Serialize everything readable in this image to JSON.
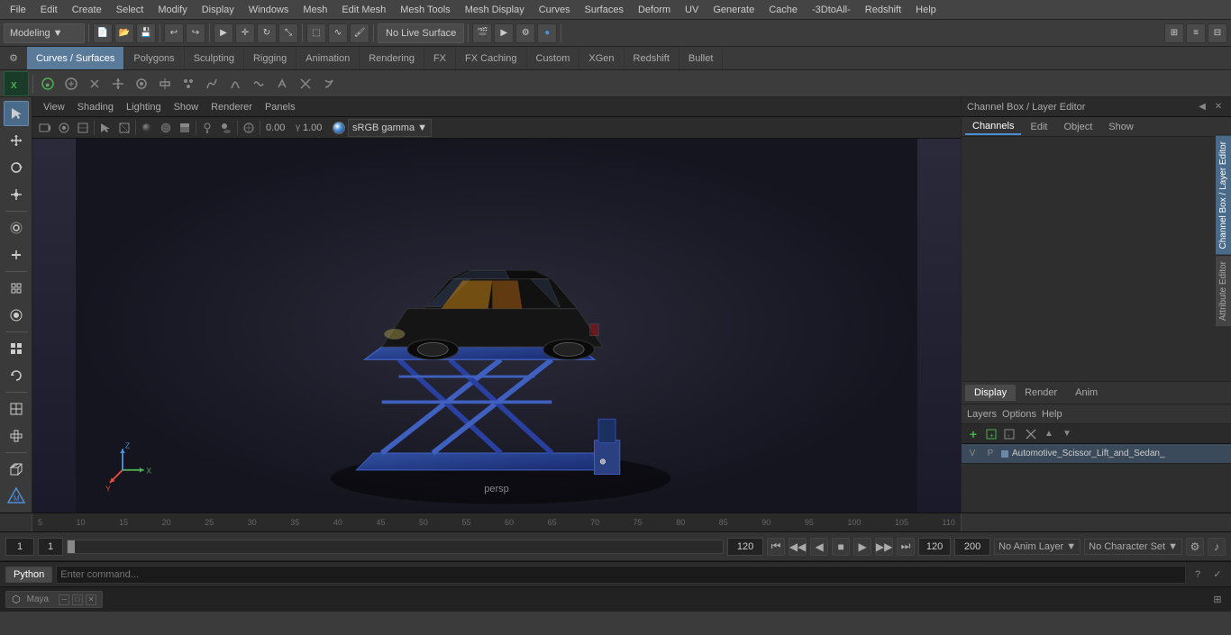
{
  "app": {
    "title": "Autodesk Maya"
  },
  "menu": {
    "items": [
      "File",
      "Edit",
      "Create",
      "Select",
      "Modify",
      "Display",
      "Windows",
      "Mesh",
      "Edit Mesh",
      "Mesh Tools",
      "Mesh Display",
      "Curves",
      "Surfaces",
      "Deform",
      "UV",
      "Generate",
      "Cache",
      "-3DtoAll-",
      "Redshift",
      "Help"
    ]
  },
  "toolbar": {
    "modeling_label": "Modeling",
    "live_surface": "No Live Surface"
  },
  "mode_tabs": {
    "tabs": [
      "Curves / Surfaces",
      "Polygons",
      "Sculpting",
      "Rigging",
      "Animation",
      "Rendering",
      "FX",
      "FX Caching",
      "Custom",
      "XGen",
      "Redshift",
      "Bullet"
    ]
  },
  "viewport": {
    "menus": [
      "View",
      "Shading",
      "Lighting",
      "Show",
      "Renderer",
      "Panels"
    ],
    "label": "persp",
    "gamma_value": "0.00",
    "gamma_mult": "1.00",
    "color_space": "sRGB gamma",
    "camera_name": "persp"
  },
  "channel_box": {
    "title": "Channel Box / Layer Editor",
    "tabs": [
      "Channels",
      "Edit",
      "Object",
      "Show"
    ]
  },
  "display_tabs": [
    "Display",
    "Render",
    "Anim"
  ],
  "layers": {
    "header_tabs": [
      "Layers",
      "Options",
      "Help"
    ],
    "layer_name": "Automotive_Scissor_Lift_and_Sedan_"
  },
  "timeline": {
    "ruler_marks": [
      "5",
      "10",
      "15",
      "20",
      "25",
      "30",
      "35",
      "40",
      "45",
      "50",
      "55",
      "60",
      "65",
      "70",
      "75",
      "80",
      "85",
      "90",
      "95",
      "100",
      "105",
      "110"
    ],
    "current_frame": "1",
    "range_start": "1",
    "range_end": "120",
    "anim_end": "120",
    "max_frame": "200",
    "anim_layer": "No Anim Layer",
    "character_set": "No Character Set"
  },
  "status_bar": {
    "python_tab": "Python"
  },
  "taskbar": {
    "window1_label": "",
    "minimize": "─",
    "restore": "□",
    "close": "✕"
  }
}
